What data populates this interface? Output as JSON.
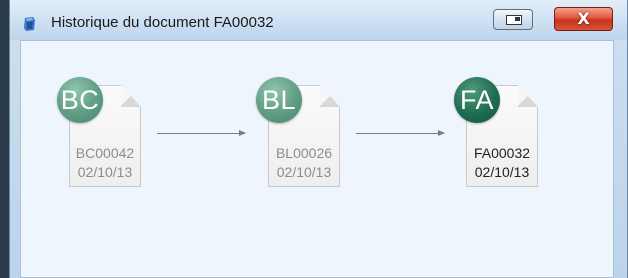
{
  "window": {
    "title": "Historique du document FA00032",
    "restore_label": "",
    "close_label": "X"
  },
  "documents": [
    {
      "badge": "BC",
      "code": "BC00042",
      "date": "02/10/13",
      "state": "faded"
    },
    {
      "badge": "BL",
      "code": "BL00026",
      "date": "02/10/13",
      "state": "faded"
    },
    {
      "badge": "FA",
      "code": "FA00032",
      "date": "02/10/13",
      "state": "active"
    }
  ],
  "colors": {
    "badge_faded": "#5f9c84",
    "badge_active": "#1f6c50",
    "arrow": "#7c7c7c",
    "content_bg": "#eef5fd"
  }
}
